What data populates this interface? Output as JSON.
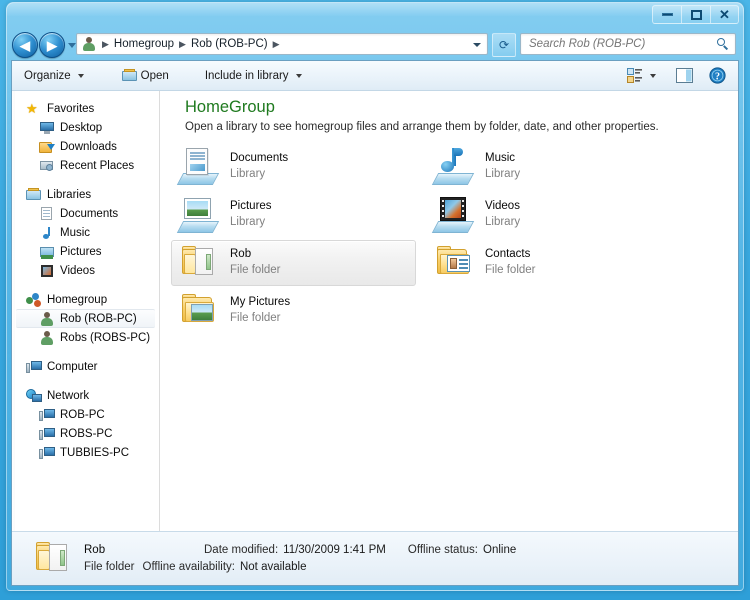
{
  "window": {
    "controls": {
      "minimize": "Minimize",
      "maximize": "Maximize",
      "close": "Close"
    }
  },
  "navigation": {
    "back_label": "Back",
    "forward_label": "Forward",
    "recent_dropdown_label": "Recent pages",
    "refresh_label": "Refresh",
    "breadcrumbs": [
      "Homegroup",
      "Rob (ROB-PC)"
    ],
    "address_dropdown_label": "Previous locations"
  },
  "search": {
    "placeholder": "Search Rob (ROB-PC)",
    "value": "",
    "icon": "search-icon"
  },
  "commandbar": {
    "organize": "Organize",
    "open": "Open",
    "include_in_library": "Include in library",
    "views_label": "Change your view",
    "preview_label": "Show the preview pane",
    "help_label": "Get help"
  },
  "sidebar": {
    "groups": [
      {
        "header": {
          "label": "Favorites",
          "icon": "star-icon"
        },
        "items": [
          {
            "label": "Desktop",
            "icon": "monitor-icon"
          },
          {
            "label": "Downloads",
            "icon": "downloads-icon"
          },
          {
            "label": "Recent Places",
            "icon": "recent-places-icon"
          }
        ]
      },
      {
        "header": {
          "label": "Libraries",
          "icon": "libraries-icon"
        },
        "items": [
          {
            "label": "Documents",
            "icon": "document-icon"
          },
          {
            "label": "Music",
            "icon": "music-icon"
          },
          {
            "label": "Pictures",
            "icon": "picture-icon"
          },
          {
            "label": "Videos",
            "icon": "video-icon"
          }
        ]
      },
      {
        "header": {
          "label": "Homegroup",
          "icon": "homegroup-icon"
        },
        "items": [
          {
            "label": "Rob (ROB-PC)",
            "icon": "user-icon",
            "selected": true
          },
          {
            "label": "Robs (ROBS-PC)",
            "icon": "user-icon",
            "selected": false
          }
        ]
      },
      {
        "header": {
          "label": "Computer",
          "icon": "computer-icon"
        },
        "items": []
      },
      {
        "header": {
          "label": "Network",
          "icon": "network-icon"
        },
        "items": [
          {
            "label": "ROB-PC",
            "icon": "computer-icon"
          },
          {
            "label": "ROBS-PC",
            "icon": "computer-icon"
          },
          {
            "label": "TUBBIES-PC",
            "icon": "computer-icon"
          }
        ]
      }
    ]
  },
  "content": {
    "title": "HomeGroup",
    "subtitle": "Open a library to see homegroup files and arrange them by folder, date, and other properties.",
    "items": [
      {
        "name": "Documents",
        "sub": "Library",
        "icon": "documents-library-icon",
        "selected": false
      },
      {
        "name": "Music",
        "sub": "Library",
        "icon": "music-library-icon",
        "selected": false
      },
      {
        "name": "Pictures",
        "sub": "Library",
        "icon": "pictures-library-icon",
        "selected": false
      },
      {
        "name": "Videos",
        "sub": "Library",
        "icon": "videos-library-icon",
        "selected": false
      },
      {
        "name": "Rob",
        "sub": "File folder",
        "icon": "open-folder-icon",
        "selected": true
      },
      {
        "name": "Contacts",
        "sub": "File folder",
        "icon": "contacts-folder-icon",
        "selected": false
      },
      {
        "name": "My Pictures",
        "sub": "File folder",
        "icon": "pictures-folder-icon",
        "selected": false
      }
    ]
  },
  "details": {
    "icon": "open-folder-icon",
    "name": "Rob",
    "type": "File folder",
    "date_modified_label": "Date modified:",
    "date_modified_value": "11/30/2009 1:41 PM",
    "offline_status_label": "Offline status:",
    "offline_status_value": "Online",
    "offline_availability_label": "Offline availability:",
    "offline_availability_value": "Not available"
  },
  "colors": {
    "title_accent": "#1f7a1f",
    "glass": "#4ab6e8",
    "selection": "#f0f0f0"
  }
}
